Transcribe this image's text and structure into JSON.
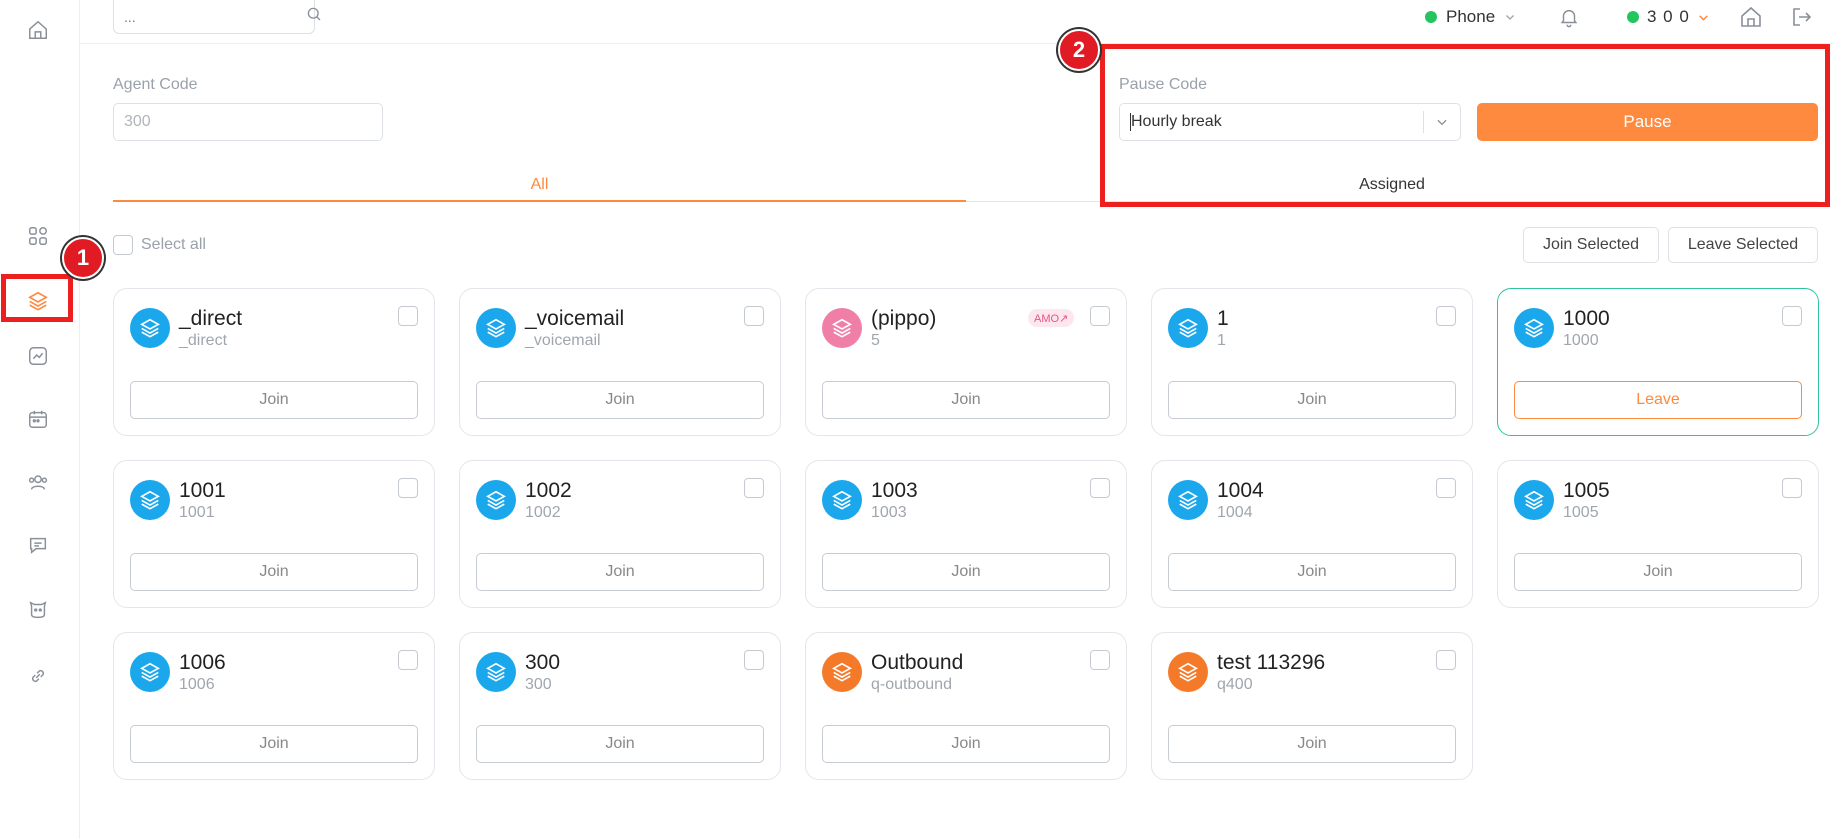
{
  "topbar": {
    "search_placeholder": "...",
    "phone_label": "Phone",
    "agent_label": "3 0 0"
  },
  "form": {
    "agent_code_label": "Agent Code",
    "agent_code_value": "300",
    "pause_code_label": "Pause Code",
    "pause_code_value": "Hourly break",
    "pause_button": "Pause"
  },
  "tabs": [
    {
      "label": "All",
      "active": true
    },
    {
      "label": "Assigned",
      "active": false
    }
  ],
  "annotations": [
    "1",
    "2"
  ],
  "toolbar": {
    "select_all": "Select all",
    "join_selected": "Join Selected",
    "leave_selected": "Leave Selected"
  },
  "colors": {
    "accent": "#fd8a3f",
    "queue_blue": "#1aa7ec",
    "queue_pink": "#f07fa8",
    "queue_orange": "#f47a2a",
    "online": "#22c55e",
    "highlight": "#ee1f1f"
  },
  "queues": [
    {
      "title": "_direct",
      "sub": "_direct",
      "action": "Join",
      "color": "blue"
    },
    {
      "title": "_voicemail",
      "sub": "_voicemail",
      "action": "Join",
      "color": "blue"
    },
    {
      "title": "(pippo)",
      "sub": "5",
      "action": "Join",
      "color": "pink",
      "tag": "AMO↗"
    },
    {
      "title": "1",
      "sub": "1",
      "action": "Join",
      "color": "blue"
    },
    {
      "title": "1000",
      "sub": "1000",
      "action": "Leave",
      "color": "blue"
    },
    {
      "title": "1001",
      "sub": "1001",
      "action": "Join",
      "color": "blue"
    },
    {
      "title": "1002",
      "sub": "1002",
      "action": "Join",
      "color": "blue"
    },
    {
      "title": "1003",
      "sub": "1003",
      "action": "Join",
      "color": "blue"
    },
    {
      "title": "1004",
      "sub": "1004",
      "action": "Join",
      "color": "blue"
    },
    {
      "title": "1005",
      "sub": "1005",
      "action": "Join",
      "color": "blue"
    },
    {
      "title": "1006",
      "sub": "1006",
      "action": "Join",
      "color": "blue"
    },
    {
      "title": "300",
      "sub": "300",
      "action": "Join",
      "color": "blue"
    },
    {
      "title": "Outbound",
      "sub": "q-outbound",
      "action": "Join",
      "color": "orange"
    },
    {
      "title": "test 113296",
      "sub": "q400",
      "action": "Join",
      "color": "orange"
    }
  ]
}
